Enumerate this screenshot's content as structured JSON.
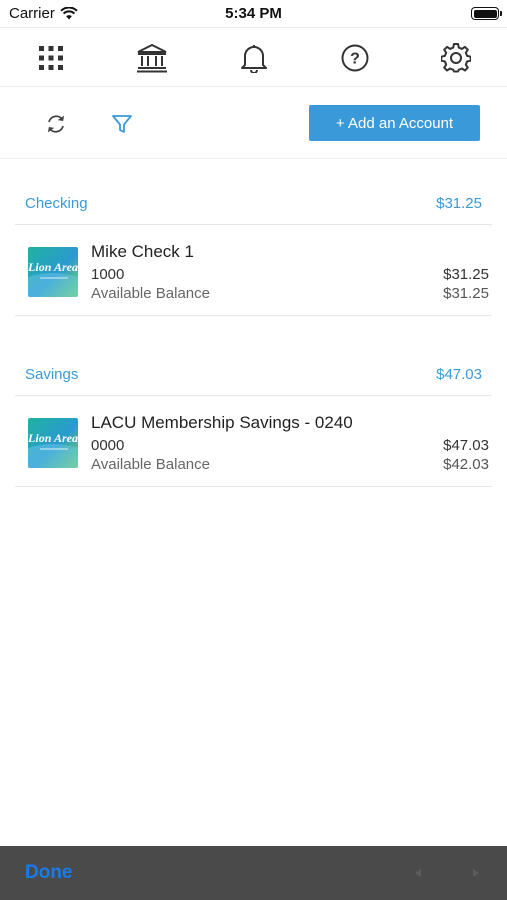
{
  "status_bar": {
    "carrier": "Carrier",
    "time": "5:34 PM"
  },
  "nav": {
    "icons": [
      "apps-grid-icon",
      "bank-icon",
      "bell-icon",
      "help-icon",
      "gear-icon"
    ]
  },
  "toolbar": {
    "refresh_icon": "refresh-icon",
    "filter_icon": "filter-icon",
    "add_account_label": "+ Add an Account"
  },
  "sections": [
    {
      "title": "Checking",
      "total": "$31.25",
      "accounts": [
        {
          "name": "Mike Check 1",
          "number": "1000",
          "balance_label": "Available Balance",
          "amount": "$31.25",
          "available": "$31.25"
        }
      ]
    },
    {
      "title": "Savings",
      "total": "$47.03",
      "accounts": [
        {
          "name": "LACU Membership Savings - 0240",
          "number": "0000",
          "balance_label": "Available Balance",
          "amount": "$47.03",
          "available": "$42.03"
        }
      ]
    }
  ],
  "bottom_bar": {
    "done_label": "Done"
  },
  "colors": {
    "accent": "#3a9ad9",
    "bottom_bar": "#4a4a4a",
    "done": "#1a7be8"
  }
}
